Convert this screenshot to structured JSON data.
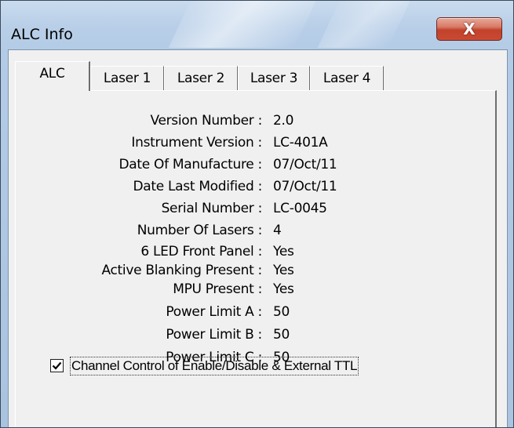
{
  "window": {
    "title": "ALC Info",
    "close_glyph": "X"
  },
  "tabs": [
    {
      "label": "ALC",
      "active": true
    },
    {
      "label": "Laser 1",
      "active": false
    },
    {
      "label": "Laser 2",
      "active": false
    },
    {
      "label": "Laser 3",
      "active": false
    },
    {
      "label": "Laser 4",
      "active": false
    }
  ],
  "info": {
    "rows": [
      {
        "label": "Version Number :",
        "value": "2.0"
      },
      {
        "label": "Instrument Version :",
        "value": "LC-401A"
      },
      {
        "label": "Date Of Manufacture :",
        "value": "07/Oct/11"
      },
      {
        "label": "Date Last Modified :",
        "value": "07/Oct/11"
      },
      {
        "label": "Serial Number :",
        "value": "LC-0045"
      },
      {
        "label": "Number Of Lasers :",
        "value": "4"
      },
      {
        "label": "6 LED Front Panel :",
        "value": "Yes"
      },
      {
        "label": "Active Blanking Present :",
        "value": "Yes"
      },
      {
        "label": "MPU Present :",
        "value": "Yes"
      },
      {
        "label": "Power Limit A :",
        "value": "50"
      },
      {
        "label": "Power Limit B :",
        "value": "50"
      },
      {
        "label": "Power Limit C :",
        "value": "50"
      }
    ]
  },
  "channel_control": {
    "label": "Channel Control of Enable/Disable & External TTL",
    "checked": true
  },
  "icons": {
    "close": "close-icon",
    "check": "check-icon"
  }
}
